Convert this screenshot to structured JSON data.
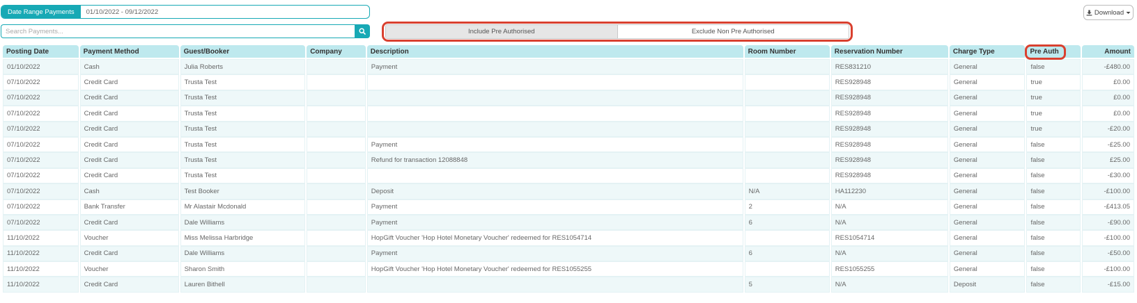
{
  "date_range": {
    "label": "Date Range Payments",
    "value": "01/10/2022 - 09/12/2022"
  },
  "search": {
    "placeholder": "Search Payments..."
  },
  "toggle": {
    "include": "Include Pre Authorised",
    "exclude": "Exclude Non Pre Authorised"
  },
  "download": {
    "label": "Download"
  },
  "colors": {
    "accent": "#17a9b5",
    "highlight": "#d9402f",
    "header_bg": "#bee9ee"
  },
  "table": {
    "headers": [
      "Posting Date",
      "Payment Method",
      "Guest/Booker",
      "Company",
      "Description",
      "Room Number",
      "Reservation Number",
      "Charge Type",
      "Pre Auth",
      "Amount"
    ],
    "rows": [
      [
        "01/10/2022",
        "Cash",
        "Julia Roberts",
        "",
        "Payment",
        "",
        "RES831210",
        "General",
        "false",
        "-£480.00"
      ],
      [
        "07/10/2022",
        "Credit Card",
        "Trusta Test",
        "",
        "",
        "",
        "RES928948",
        "General",
        "true",
        "£0.00"
      ],
      [
        "07/10/2022",
        "Credit Card",
        "Trusta Test",
        "",
        "",
        "",
        "RES928948",
        "General",
        "true",
        "£0.00"
      ],
      [
        "07/10/2022",
        "Credit Card",
        "Trusta Test",
        "",
        "",
        "",
        "RES928948",
        "General",
        "true",
        "£0.00"
      ],
      [
        "07/10/2022",
        "Credit Card",
        "Trusta Test",
        "",
        "",
        "",
        "RES928948",
        "General",
        "true",
        "-£20.00"
      ],
      [
        "07/10/2022",
        "Credit Card",
        "Trusta Test",
        "",
        "Payment",
        "",
        "RES928948",
        "General",
        "false",
        "-£25.00"
      ],
      [
        "07/10/2022",
        "Credit Card",
        "Trusta Test",
        "",
        "Refund for transaction 12088848",
        "",
        "RES928948",
        "General",
        "false",
        "£25.00"
      ],
      [
        "07/10/2022",
        "Credit Card",
        "Trusta Test",
        "",
        "",
        "",
        "RES928948",
        "General",
        "false",
        "-£30.00"
      ],
      [
        "07/10/2022",
        "Cash",
        "Test Booker",
        "",
        "Deposit",
        "N/A",
        "HA112230",
        "General",
        "false",
        "-£100.00"
      ],
      [
        "07/10/2022",
        "Bank Transfer",
        "Mr Alastair Mcdonald",
        "",
        "Payment",
        "2",
        "N/A",
        "General",
        "false",
        "-£413.05"
      ],
      [
        "07/10/2022",
        "Credit Card",
        "Dale Williams",
        "",
        "Payment",
        "6",
        "N/A",
        "General",
        "false",
        "-£90.00"
      ],
      [
        "11/10/2022",
        "Voucher",
        "Miss Melissa Harbridge",
        "",
        "HopGift Voucher 'Hop Hotel Monetary Voucher' redeemed for RES1054714",
        "",
        "RES1054714",
        "General",
        "false",
        "-£100.00"
      ],
      [
        "11/10/2022",
        "Credit Card",
        "Dale Williams",
        "",
        "Payment",
        "6",
        "N/A",
        "General",
        "false",
        "-£50.00"
      ],
      [
        "11/10/2022",
        "Voucher",
        "Sharon Smith",
        "",
        "HopGift Voucher 'Hop Hotel Monetary Voucher' redeemed for RES1055255",
        "",
        "RES1055255",
        "General",
        "false",
        "-£100.00"
      ],
      [
        "11/10/2022",
        "Credit Card",
        "Lauren Bithell",
        "",
        "",
        "5",
        "N/A",
        "Deposit",
        "false",
        "-£15.00"
      ]
    ]
  }
}
